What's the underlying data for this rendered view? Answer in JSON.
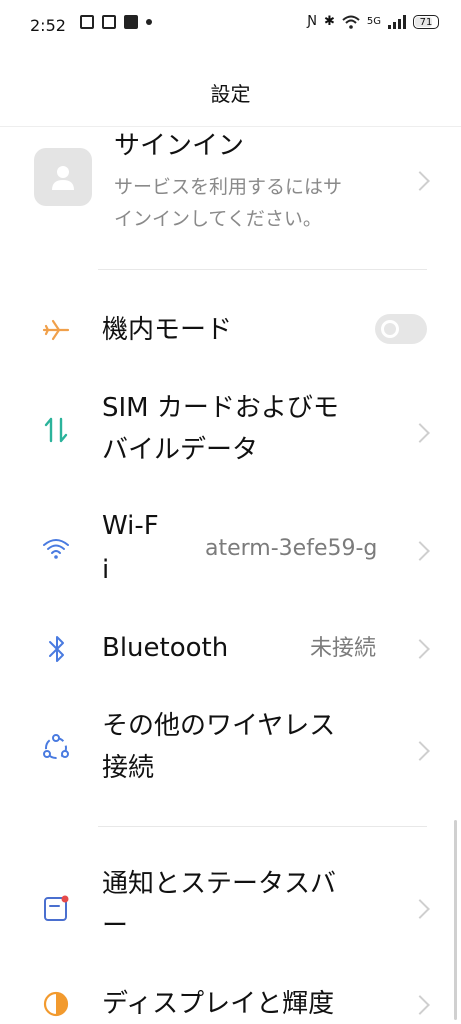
{
  "status_bar": {
    "time": "2:52",
    "network_label": "5G",
    "battery": "71"
  },
  "header": {
    "title": "設定"
  },
  "account": {
    "label": "サインイン",
    "subtitle_line1": "サービスを利用するにはサ",
    "subtitle_line2": "インインしてください。"
  },
  "items": {
    "airplane": {
      "label": "機内モード",
      "toggle_on": false
    },
    "sim": {
      "label_line1": "SIM カードおよびモ",
      "label_line2": "バイルデータ"
    },
    "wifi": {
      "label_line1": "Wi-F",
      "label_line2": "i",
      "value": "aterm-3efe59-g"
    },
    "bluetooth": {
      "label": "Bluetooth",
      "value": "未接続"
    },
    "wireless": {
      "label_line1": "その他のワイヤレス",
      "label_line2": "接続"
    },
    "notifications": {
      "label_line1": "通知とステータスバ",
      "label_line2": "ー"
    },
    "display": {
      "label": "ディスプレイと輝度"
    }
  },
  "colors": {
    "airplane_icon": "#f0a04b",
    "sim_icon": "#2bb39b",
    "wifi_icon": "#4a7be0",
    "bluetooth_icon": "#4a7be0",
    "wireless_icon": "#4a7be0",
    "notification_icon": "#4a6fcf",
    "notification_dot": "#e64a4a",
    "display_icon": "#f29a2e"
  }
}
